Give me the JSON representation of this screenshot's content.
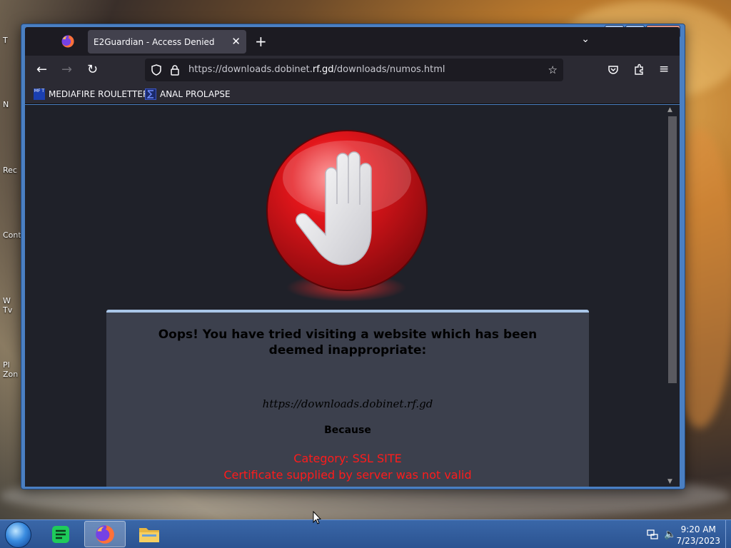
{
  "desktop": {
    "icons": [
      {
        "label": "T"
      },
      {
        "label": "N"
      },
      {
        "label": "Rec"
      },
      {
        "label": "Cont"
      },
      {
        "label": "W\nTv"
      },
      {
        "label": "Pl\nZon"
      }
    ]
  },
  "browser": {
    "tab": {
      "title": "E2Guardian - Access Denied"
    },
    "url": {
      "prefix": "https://downloads.dobinet.",
      "highlight": "rf.gd",
      "suffix": "/downloads/numos.html"
    },
    "bookmarks": [
      {
        "label": "MEDIAFIRE ROULETTER",
        "icon": "MF T"
      },
      {
        "label": "ANAL PROLAPSE"
      }
    ]
  },
  "page": {
    "title": "Oops! You have tried visiting a website which has been deemed inappropriate:",
    "blocked_url": "https://downloads.dobinet.rf.gd",
    "because": "Because",
    "category": "Category: SSL SITE",
    "reason": "Certificate supplied by server was not valid"
  },
  "taskbar": {
    "time": "9:20 AM",
    "date": "7/23/2023"
  },
  "colors": {
    "accent_red": "#ff1b1b",
    "window_frame": "#4a7fc2",
    "page_bg": "#1f2129",
    "panel_bg": "#3c404d"
  }
}
